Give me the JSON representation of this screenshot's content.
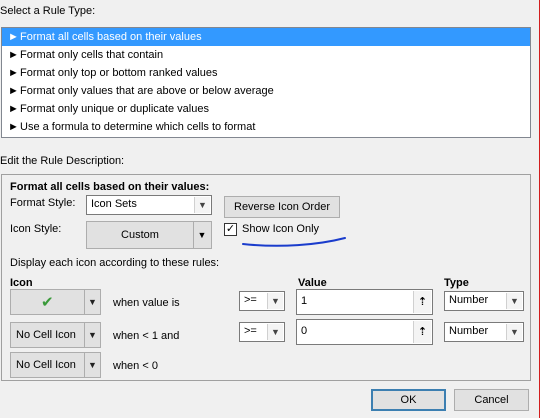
{
  "rule_type": {
    "header": "Select a Rule Type:",
    "items": [
      {
        "label": "Format all cells based on their values",
        "selected": true
      },
      {
        "label": "Format only cells that contain",
        "selected": false
      },
      {
        "label": "Format only top or bottom ranked values",
        "selected": false
      },
      {
        "label": "Format only values that are above or below average",
        "selected": false
      },
      {
        "label": "Format only unique or duplicate values",
        "selected": false
      },
      {
        "label": "Use a formula to determine which cells to format",
        "selected": false
      }
    ]
  },
  "description": {
    "header": "Edit the Rule Description:",
    "section_title": "Format all cells based on their values:",
    "format_style_label": "Format Style:",
    "format_style_value": "Icon Sets",
    "reverse_button": "Reverse Icon Order",
    "icon_style_label": "Icon Style:",
    "icon_style_value": "Custom",
    "show_icon_only_label": "Show Icon Only",
    "show_icon_only_checked": "✓",
    "display_rules_label": "Display each icon according to these rules:",
    "col_icon": "Icon",
    "col_value": "Value",
    "col_type": "Type",
    "rows": [
      {
        "icon": "✔",
        "icon_name": "green-check-icon",
        "condition": "when value is",
        "operator": ">=",
        "value": "1",
        "type": "Number"
      },
      {
        "icon": "No Cell Icon",
        "condition": "when < 1 and",
        "operator": ">=",
        "value": "0",
        "type": "Number"
      },
      {
        "icon": "No Cell Icon",
        "condition": "when < 0"
      }
    ]
  },
  "buttons": {
    "ok": "OK",
    "cancel": "Cancel"
  },
  "colors": {
    "selection": "#3399ff",
    "check_green": "#3a9a3a",
    "annotation_ink": "#1a3ccc"
  }
}
